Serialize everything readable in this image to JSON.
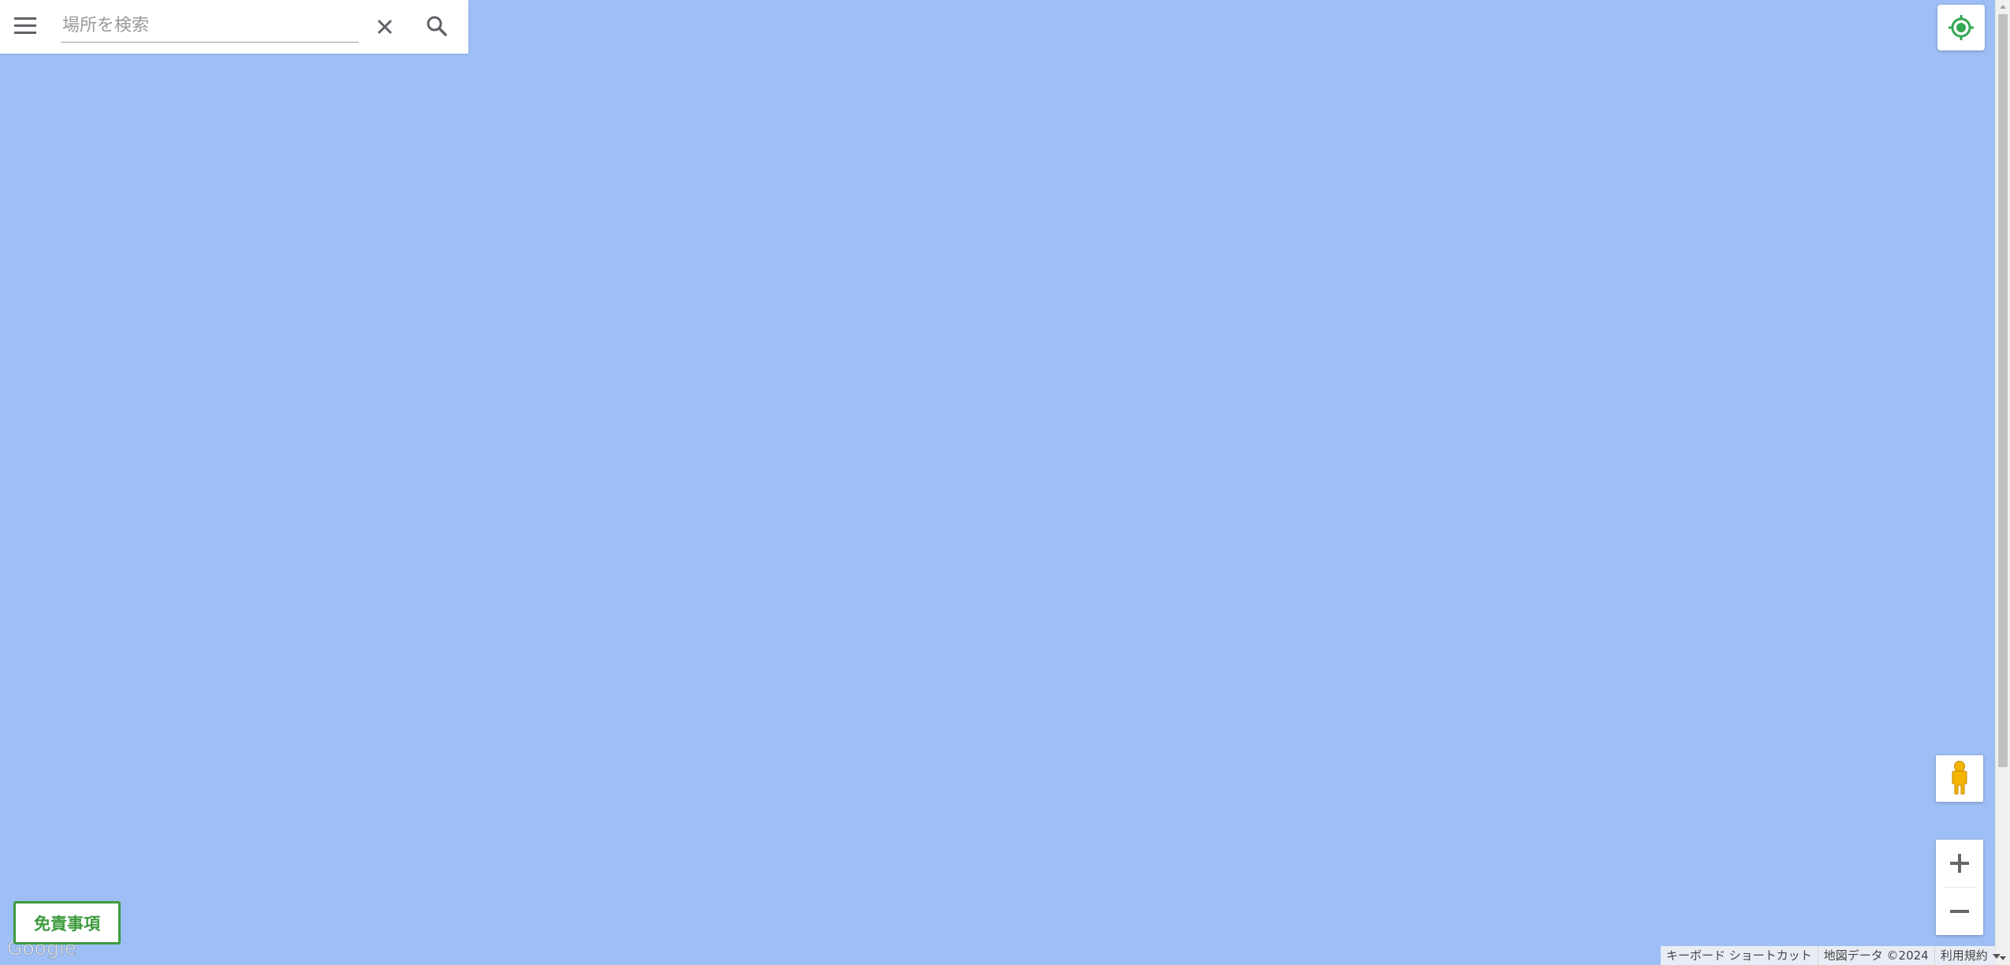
{
  "search": {
    "placeholder": "場所を検索"
  },
  "icons": {
    "menu": "menu-icon",
    "clear": "close-icon",
    "search": "search-icon",
    "locate": "my-location-icon",
    "pegman": "pegman-icon",
    "zoom_in": "plus-icon",
    "zoom_out": "minus-icon"
  },
  "disclaimer": {
    "label": "免責事項"
  },
  "logo": {
    "text": "Google"
  },
  "footer": {
    "shortcuts": "キーボード ショートカット",
    "map_data": "地図データ ©2024",
    "terms": "利用規約"
  },
  "colors": {
    "map_water": "#9ebff6",
    "accent_green": "#3d9a3d",
    "pegman_yellow": "#f4b400"
  }
}
